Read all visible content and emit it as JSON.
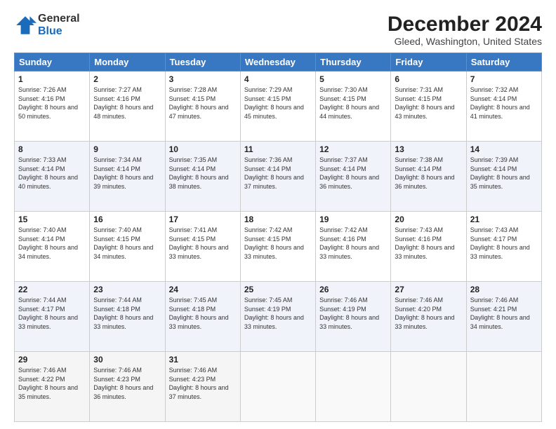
{
  "logo": {
    "general": "General",
    "blue": "Blue"
  },
  "title": "December 2024",
  "location": "Gleed, Washington, United States",
  "days_of_week": [
    "Sunday",
    "Monday",
    "Tuesday",
    "Wednesday",
    "Thursday",
    "Friday",
    "Saturday"
  ],
  "weeks": [
    [
      {
        "day": "1",
        "sunrise": "7:26 AM",
        "sunset": "4:16 PM",
        "daylight": "8 hours and 50 minutes."
      },
      {
        "day": "2",
        "sunrise": "7:27 AM",
        "sunset": "4:16 PM",
        "daylight": "8 hours and 48 minutes."
      },
      {
        "day": "3",
        "sunrise": "7:28 AM",
        "sunset": "4:15 PM",
        "daylight": "8 hours and 47 minutes."
      },
      {
        "day": "4",
        "sunrise": "7:29 AM",
        "sunset": "4:15 PM",
        "daylight": "8 hours and 45 minutes."
      },
      {
        "day": "5",
        "sunrise": "7:30 AM",
        "sunset": "4:15 PM",
        "daylight": "8 hours and 44 minutes."
      },
      {
        "day": "6",
        "sunrise": "7:31 AM",
        "sunset": "4:15 PM",
        "daylight": "8 hours and 43 minutes."
      },
      {
        "day": "7",
        "sunrise": "7:32 AM",
        "sunset": "4:14 PM",
        "daylight": "8 hours and 41 minutes."
      }
    ],
    [
      {
        "day": "8",
        "sunrise": "7:33 AM",
        "sunset": "4:14 PM",
        "daylight": "8 hours and 40 minutes."
      },
      {
        "day": "9",
        "sunrise": "7:34 AM",
        "sunset": "4:14 PM",
        "daylight": "8 hours and 39 minutes."
      },
      {
        "day": "10",
        "sunrise": "7:35 AM",
        "sunset": "4:14 PM",
        "daylight": "8 hours and 38 minutes."
      },
      {
        "day": "11",
        "sunrise": "7:36 AM",
        "sunset": "4:14 PM",
        "daylight": "8 hours and 37 minutes."
      },
      {
        "day": "12",
        "sunrise": "7:37 AM",
        "sunset": "4:14 PM",
        "daylight": "8 hours and 36 minutes."
      },
      {
        "day": "13",
        "sunrise": "7:38 AM",
        "sunset": "4:14 PM",
        "daylight": "8 hours and 36 minutes."
      },
      {
        "day": "14",
        "sunrise": "7:39 AM",
        "sunset": "4:14 PM",
        "daylight": "8 hours and 35 minutes."
      }
    ],
    [
      {
        "day": "15",
        "sunrise": "7:40 AM",
        "sunset": "4:14 PM",
        "daylight": "8 hours and 34 minutes."
      },
      {
        "day": "16",
        "sunrise": "7:40 AM",
        "sunset": "4:15 PM",
        "daylight": "8 hours and 34 minutes."
      },
      {
        "day": "17",
        "sunrise": "7:41 AM",
        "sunset": "4:15 PM",
        "daylight": "8 hours and 33 minutes."
      },
      {
        "day": "18",
        "sunrise": "7:42 AM",
        "sunset": "4:15 PM",
        "daylight": "8 hours and 33 minutes."
      },
      {
        "day": "19",
        "sunrise": "7:42 AM",
        "sunset": "4:16 PM",
        "daylight": "8 hours and 33 minutes."
      },
      {
        "day": "20",
        "sunrise": "7:43 AM",
        "sunset": "4:16 PM",
        "daylight": "8 hours and 33 minutes."
      },
      {
        "day": "21",
        "sunrise": "7:43 AM",
        "sunset": "4:17 PM",
        "daylight": "8 hours and 33 minutes."
      }
    ],
    [
      {
        "day": "22",
        "sunrise": "7:44 AM",
        "sunset": "4:17 PM",
        "daylight": "8 hours and 33 minutes."
      },
      {
        "day": "23",
        "sunrise": "7:44 AM",
        "sunset": "4:18 PM",
        "daylight": "8 hours and 33 minutes."
      },
      {
        "day": "24",
        "sunrise": "7:45 AM",
        "sunset": "4:18 PM",
        "daylight": "8 hours and 33 minutes."
      },
      {
        "day": "25",
        "sunrise": "7:45 AM",
        "sunset": "4:19 PM",
        "daylight": "8 hours and 33 minutes."
      },
      {
        "day": "26",
        "sunrise": "7:46 AM",
        "sunset": "4:19 PM",
        "daylight": "8 hours and 33 minutes."
      },
      {
        "day": "27",
        "sunrise": "7:46 AM",
        "sunset": "4:20 PM",
        "daylight": "8 hours and 33 minutes."
      },
      {
        "day": "28",
        "sunrise": "7:46 AM",
        "sunset": "4:21 PM",
        "daylight": "8 hours and 34 minutes."
      }
    ],
    [
      {
        "day": "29",
        "sunrise": "7:46 AM",
        "sunset": "4:22 PM",
        "daylight": "8 hours and 35 minutes."
      },
      {
        "day": "30",
        "sunrise": "7:46 AM",
        "sunset": "4:23 PM",
        "daylight": "8 hours and 36 minutes."
      },
      {
        "day": "31",
        "sunrise": "7:46 AM",
        "sunset": "4:23 PM",
        "daylight": "8 hours and 37 minutes."
      },
      null,
      null,
      null,
      null
    ]
  ]
}
